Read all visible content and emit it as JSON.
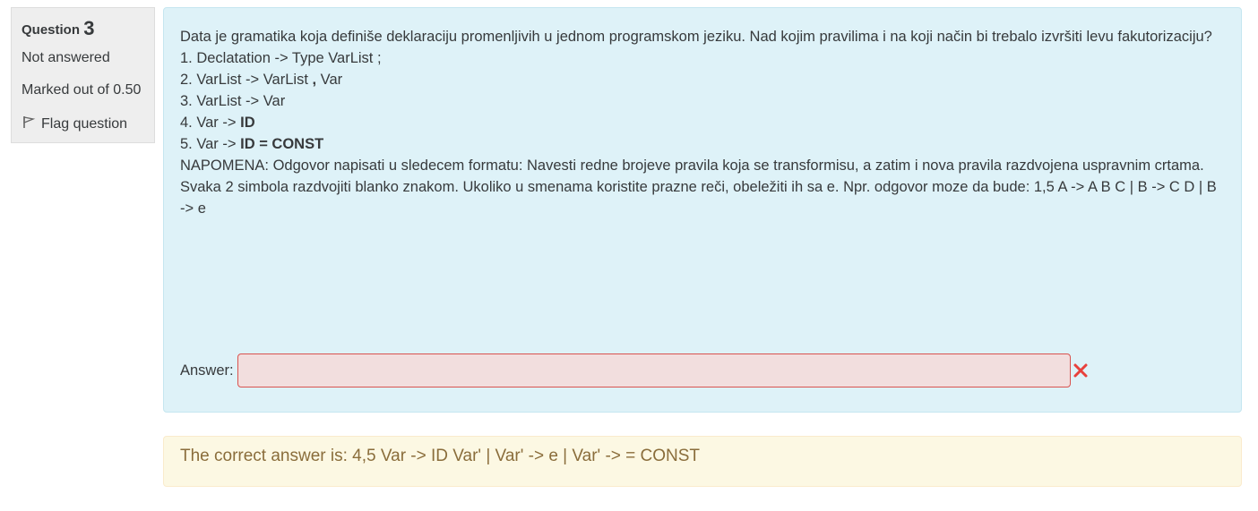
{
  "info": {
    "question_label": "Question",
    "question_number": "3",
    "state": "Not answered",
    "grade": "Marked out of 0.50",
    "flag_label": "Flag question"
  },
  "question": {
    "intro": "Data  je gramatika koja definiše deklaraciju promenljivih u jednom programskom jeziku. Nad kojim pravilima i na koji način bi trebalo izvršiti levu fakutorizaciju?",
    "rules": [
      {
        "plain": "1. Declatation -> Type VarList ;",
        "bold": ""
      },
      {
        "plain": "2. VarList -> VarList ",
        "bold": ",",
        "after": " Var"
      },
      {
        "plain": "3. VarList -> Var",
        "bold": ""
      },
      {
        "plain": "4. Var -> ",
        "bold": "ID"
      },
      {
        "plain": "5. Var -> ",
        "bold": "ID = CONST"
      }
    ],
    "note": "NAPOMENA: Odgovor napisati u sledecem formatu: Navesti redne brojeve pravila koja se transformisu, a zatim i nova pravila razdvojena uspravnim crtama. Svaka 2 simbola razdvojiti blanko znakom. Ukoliko u smenama koristite prazne reči, obeležiti ih sa e. Npr. odgovor moze da bude: 1,5 A -> A B C | B -> C D | B -> e",
    "answer_label": "Answer:",
    "answer_value": ""
  },
  "feedback": {
    "text": "The correct answer is: 4,5 Var -> ID Var' | Var' -> e | Var' -> = CONST"
  },
  "colors": {
    "question_bg": "#def2f8",
    "feedback_bg": "#fcf8e3",
    "error": "#d9534f"
  },
  "icons": {
    "flag": "flag-icon",
    "incorrect": "incorrect-x-icon"
  }
}
